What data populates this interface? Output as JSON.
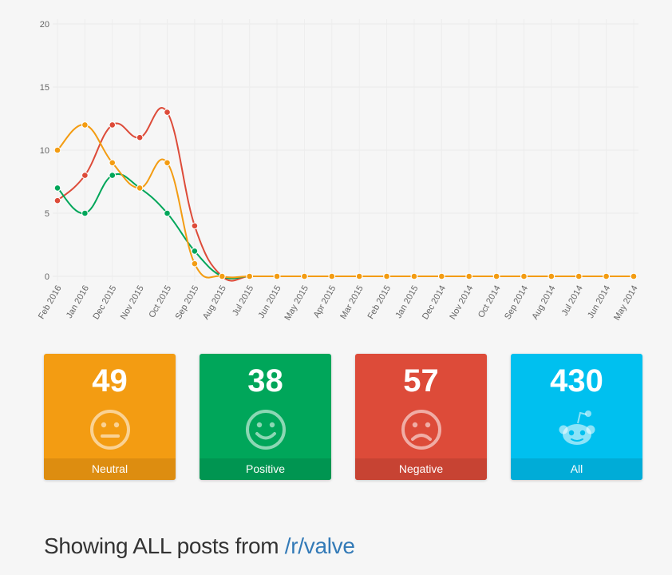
{
  "chart_data": {
    "type": "line",
    "categories": [
      "Feb 2016",
      "Jan 2016",
      "Dec 2015",
      "Nov 2015",
      "Oct 2015",
      "Sep 2015",
      "Aug 2015",
      "Jul 2015",
      "Jun 2015",
      "May 2015",
      "Apr 2015",
      "Mar 2015",
      "Feb 2015",
      "Jan 2015",
      "Dec 2014",
      "Nov 2014",
      "Oct 2014",
      "Sep 2014",
      "Aug 2014",
      "Jul 2014",
      "Jun 2014",
      "May 2014"
    ],
    "series": [
      {
        "color": "#dd4b39",
        "values": [
          6,
          8,
          12,
          11,
          13,
          4,
          0,
          0,
          0,
          0,
          0,
          0,
          0,
          0,
          0,
          0,
          0,
          0,
          0,
          0,
          0,
          0
        ]
      },
      {
        "color": "#00a65a",
        "values": [
          7,
          5,
          8,
          7,
          5,
          2,
          0,
          0,
          0,
          0,
          0,
          0,
          0,
          0,
          0,
          0,
          0,
          0,
          0,
          0,
          0,
          0
        ]
      },
      {
        "color": "#f39c12",
        "values": [
          10,
          12,
          9,
          7,
          9,
          1,
          0,
          0,
          0,
          0,
          0,
          0,
          0,
          0,
          0,
          0,
          0,
          0,
          0,
          0,
          0,
          0
        ]
      }
    ],
    "ylim": [
      0,
      20
    ],
    "yticks": [
      0,
      5,
      10,
      15,
      20
    ],
    "grid": true,
    "title": "",
    "xlabel": "",
    "ylabel": ""
  },
  "stats": [
    {
      "count": "49",
      "label": "Neutral",
      "icon": "neutral-face-icon",
      "color": "#f39c12",
      "footer_color": "#dd8d10"
    },
    {
      "count": "38",
      "label": "Positive",
      "icon": "smile-face-icon",
      "color": "#00a65a",
      "footer_color": "#009551"
    },
    {
      "count": "57",
      "label": "Negative",
      "icon": "frown-face-icon",
      "color": "#dd4b39",
      "footer_color": "#c74333"
    },
    {
      "count": "430",
      "label": "All",
      "icon": "reddit-alien-icon",
      "color": "#00c0ef",
      "footer_color": "#00acd7"
    }
  ],
  "heading": {
    "prefix": "Showing ALL posts from ",
    "link": "/r/valve"
  }
}
